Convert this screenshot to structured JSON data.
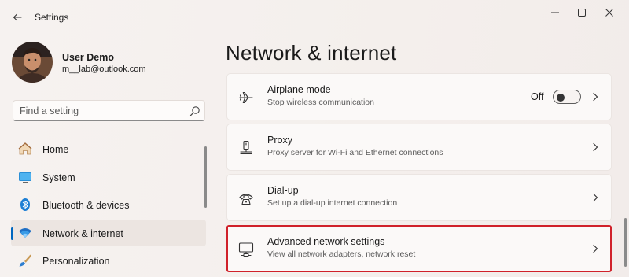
{
  "window": {
    "title": "Settings",
    "controls": [
      "minimize-icon",
      "maximize-icon",
      "close-icon"
    ]
  },
  "user": {
    "name": "User Demo",
    "email": "m__lab@outlook.com"
  },
  "search": {
    "placeholder": "Find a setting",
    "value": ""
  },
  "nav": {
    "items": [
      {
        "label": "Home",
        "icon": "home-icon",
        "selected": false
      },
      {
        "label": "System",
        "icon": "system-icon",
        "selected": false
      },
      {
        "label": "Bluetooth & devices",
        "icon": "bluetooth-icon",
        "selected": false
      },
      {
        "label": "Network & internet",
        "icon": "wifi-icon",
        "selected": true
      },
      {
        "label": "Personalization",
        "icon": "brush-icon",
        "selected": false
      }
    ]
  },
  "main": {
    "title": "Network & internet",
    "cards": [
      {
        "title": "Airplane mode",
        "subtitle": "Stop wireless communication",
        "icon": "airplane-icon",
        "toggle_label": "Off",
        "toggle_on": false
      },
      {
        "title": "Proxy",
        "subtitle": "Proxy server for Wi-Fi and Ethernet connections",
        "icon": "proxy-icon"
      },
      {
        "title": "Dial-up",
        "subtitle": "Set up a dial-up internet connection",
        "icon": "dialup-icon"
      },
      {
        "title": "Advanced network settings",
        "subtitle": "View all network adapters, network reset",
        "icon": "network-adapter-icon",
        "highlighted": true
      }
    ]
  },
  "colors": {
    "accent": "#0067c0",
    "highlight_border": "#d0212a"
  }
}
